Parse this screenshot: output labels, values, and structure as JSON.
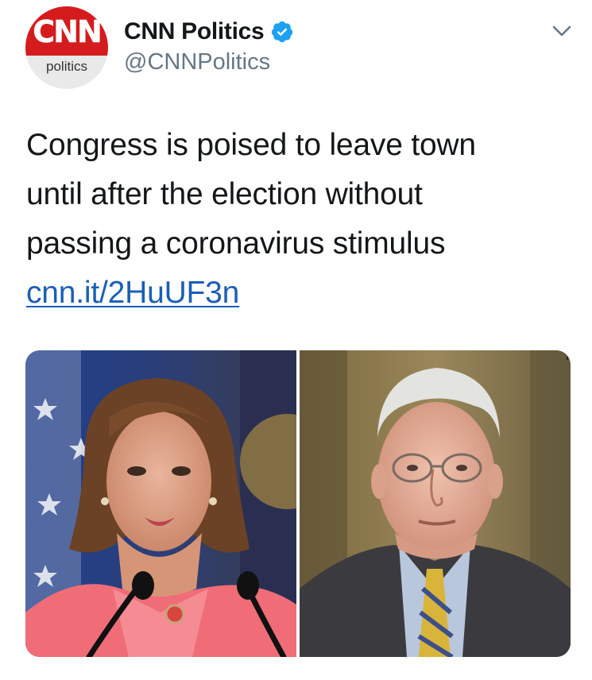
{
  "account": {
    "avatar_logo": "CNN",
    "avatar_subtitle": "politics",
    "display_name": "CNN Politics",
    "handle": "@CNNPolitics",
    "verified": true,
    "brand_color": "#d41c1f",
    "verified_color": "#1da1f2"
  },
  "tweet": {
    "text_lines": [
      "Congress is poised to leave town",
      "until after the election without",
      "passing a coronavirus stimulus"
    ],
    "link_text": "cnn.it/2HuUF3n",
    "link_color": "#1b5fb6"
  },
  "media": {
    "images": [
      {
        "description_icon": "photo-woman-pink-jacket"
      },
      {
        "description_icon": "photo-man-suit-yellow-tie"
      }
    ]
  },
  "icons": {
    "verified": "verified-badge-icon",
    "menu": "chevron-down-icon"
  }
}
